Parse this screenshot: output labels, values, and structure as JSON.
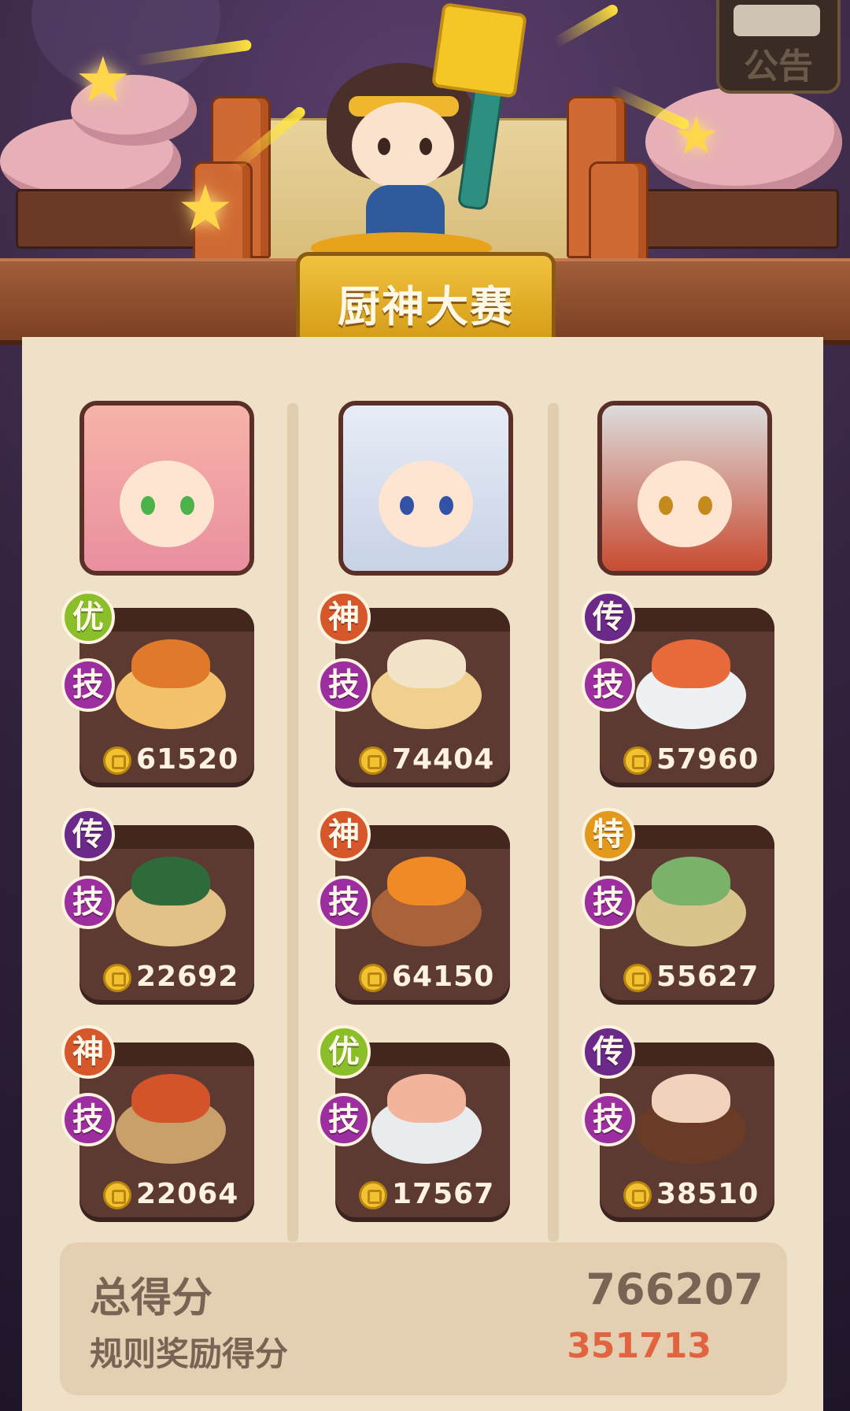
{
  "header": {
    "title": "厨神大赛",
    "notice_label": "公告"
  },
  "colors": {
    "badge_you": "#8bbf2a",
    "badge_shen": "#d6582a",
    "badge_chuan": "#6b2a8a",
    "badge_te": "#e39a1c",
    "badge_ji": "#9c2ea0",
    "score_bonus": "#e06440"
  },
  "chefs": [
    {
      "dishes": [
        {
          "grade": "优",
          "skill": "技",
          "score": "61520"
        },
        {
          "grade": "传",
          "skill": "技",
          "score": "22692"
        },
        {
          "grade": "神",
          "skill": "技",
          "score": "22064"
        }
      ]
    },
    {
      "dishes": [
        {
          "grade": "神",
          "skill": "技",
          "score": "74404"
        },
        {
          "grade": "神",
          "skill": "技",
          "score": "64150"
        },
        {
          "grade": "优",
          "skill": "技",
          "score": "17567"
        }
      ]
    },
    {
      "dishes": [
        {
          "grade": "传",
          "skill": "技",
          "score": "57960"
        },
        {
          "grade": "特",
          "skill": "技",
          "score": "55627"
        },
        {
          "grade": "传",
          "skill": "技",
          "score": "38510"
        }
      ]
    }
  ],
  "summary": {
    "total_label": "总得分",
    "total_value": "766207",
    "bonus_label": "规则奖励得分",
    "bonus_value": "351713"
  }
}
